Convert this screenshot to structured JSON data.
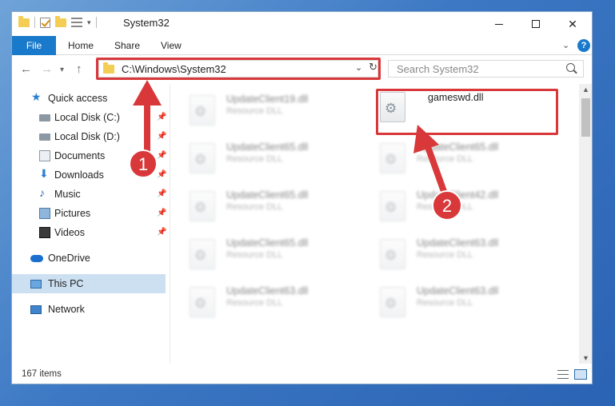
{
  "window": {
    "title": "System32",
    "minimize_icon": "minimize-icon",
    "maximize_icon": "maximize-icon",
    "close_icon": "close-icon"
  },
  "ribbon": {
    "tabs": [
      "File",
      "Home",
      "Share",
      "View"
    ]
  },
  "navigation": {
    "address": "C:\\Windows\\System32",
    "search_placeholder": "Search System32"
  },
  "sidebar": {
    "items": [
      {
        "label": "Quick access",
        "icon": "star-icon",
        "pinned": false
      },
      {
        "label": "Local Disk (C:)",
        "icon": "disk-icon",
        "pinned": true
      },
      {
        "label": "Local Disk (D:)",
        "icon": "disk-icon",
        "pinned": true
      },
      {
        "label": "Documents",
        "icon": "documents-icon",
        "pinned": true
      },
      {
        "label": "Downloads",
        "icon": "download-icon",
        "pinned": true
      },
      {
        "label": "Music",
        "icon": "music-icon",
        "pinned": true
      },
      {
        "label": "Pictures",
        "icon": "pictures-icon",
        "pinned": true
      },
      {
        "label": "Videos",
        "icon": "videos-icon",
        "pinned": true
      },
      {
        "label": "OneDrive",
        "icon": "cloud-icon",
        "pinned": false
      },
      {
        "label": "This PC",
        "icon": "computer-icon",
        "pinned": false,
        "selected": true
      },
      {
        "label": "Network",
        "icon": "network-icon",
        "pinned": false
      }
    ]
  },
  "files": [
    {
      "name": "UpdateClient19.dll",
      "type": "Resource DLL"
    },
    {
      "name": "gameswd.dll",
      "type": ""
    },
    {
      "name": "UpdateClient65.dll",
      "type": "Resource DLL"
    },
    {
      "name": "UpdateClient65.dll",
      "type": "Resource DLL"
    },
    {
      "name": "UpdateClient65.dll",
      "type": "Resource DLL"
    },
    {
      "name": "UpdateClient42.dll",
      "type": "Resource DLL"
    },
    {
      "name": "UpdateClient65.dll",
      "type": "Resource DLL"
    },
    {
      "name": "UpdateClient63.dll",
      "type": "Resource DLL"
    },
    {
      "name": "UpdateClient63.dll",
      "type": "Resource DLL"
    },
    {
      "name": "UpdateClient63.dll",
      "type": "Resource DLL"
    }
  ],
  "status": {
    "item_count": "167 items"
  },
  "annotations": {
    "step1": "1",
    "step2": "2",
    "color": "#d9383b"
  }
}
